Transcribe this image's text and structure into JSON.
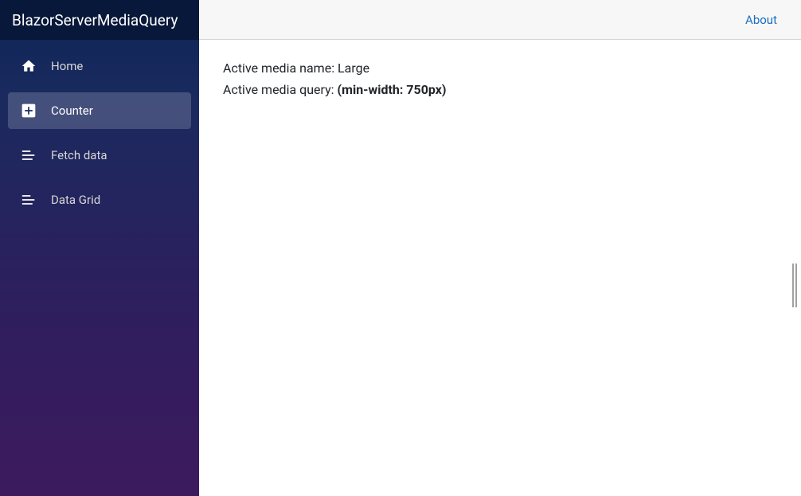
{
  "sidebar": {
    "brand": "BlazorServerMediaQuery",
    "items": [
      {
        "label": "Home",
        "icon": "home-icon",
        "active": false
      },
      {
        "label": "Counter",
        "icon": "plus-icon",
        "active": true
      },
      {
        "label": "Fetch data",
        "icon": "list-icon",
        "active": false
      },
      {
        "label": "Data Grid",
        "icon": "list-icon",
        "active": false
      }
    ]
  },
  "topbar": {
    "about_label": "About"
  },
  "content": {
    "line1_label": "Active media name: ",
    "line1_value": "Large",
    "line2_label": "Active media query: ",
    "line2_value": "(min-width: 750px)"
  }
}
